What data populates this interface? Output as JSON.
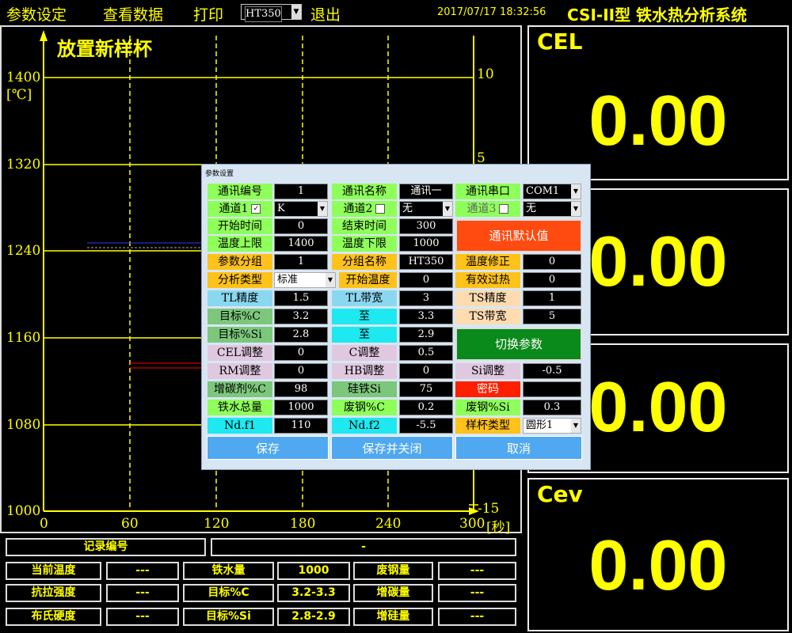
{
  "menu": {
    "params": "参数设定",
    "view": "查看数据",
    "print": "打印",
    "grade_select": "HT350",
    "exit": "退出",
    "datetime": "2017/07/17 18:32:56",
    "system_title": "CSI-II型 铁水热分析系统"
  },
  "chart": {
    "title": "放置新样杯",
    "yunit": "[℃]",
    "y_ticks": [
      "1400",
      "1320",
      "1240",
      "1160",
      "1080",
      "1000"
    ],
    "x_ticks": [
      "0",
      "60",
      "120",
      "180",
      "240",
      "300"
    ],
    "xunit": "[秒]",
    "y2_ticks": [
      "10",
      "5",
      "-15"
    ]
  },
  "chart_data": {
    "type": "line",
    "title": "",
    "xlabel": "[秒]",
    "ylabel": "[℃]",
    "xlim": [
      0,
      300
    ],
    "ylim": [
      1000,
      1400
    ],
    "y2lim": [
      -15,
      10
    ],
    "grid": true,
    "series": []
  },
  "panels": [
    {
      "label": "CEL",
      "value": "0.00"
    },
    {
      "label": "",
      "value": "0.00"
    },
    {
      "label": "",
      "value": "0.00"
    },
    {
      "label": "Cev",
      "value": "0.00"
    }
  ],
  "bottom": {
    "record_label": "记录编号",
    "record_value": "-",
    "rows": [
      [
        "当前温度",
        "---",
        "铁水量",
        "1000",
        "废钢量",
        "---"
      ],
      [
        "抗拉强度",
        "---",
        "目标%C",
        "3.2-3.3",
        "增碳量",
        "---"
      ],
      [
        "布氏硬度",
        "---",
        "目标%Si",
        "2.8-2.9",
        "增硅量",
        "---"
      ]
    ]
  },
  "dialog": {
    "caption": "参数设置",
    "comm_no_label": "通讯编号",
    "comm_no": "1",
    "comm_name_label": "通讯名称",
    "comm_name": "通讯一",
    "comm_port_label": "通讯串口",
    "comm_port": "COM1",
    "ch1_label": "通道1",
    "ch1": "K",
    "ch2_label": "通道2",
    "ch2": "无",
    "ch3_label": "通道3",
    "ch3": "无",
    "start_time_label": "开始时间",
    "start_time": "0",
    "end_time_label": "结束时间",
    "end_time": "300",
    "default_btn": "通讯默认值",
    "temp_upper_label": "温度上限",
    "temp_upper": "1400",
    "temp_lower_label": "温度下限",
    "temp_lower": "1000",
    "group_label": "参数分组",
    "group": "1",
    "group_name_label": "分组名称",
    "group_name": "HT350",
    "temp_corr_label": "温度修正",
    "temp_corr": "0",
    "analysis_type_label": "分析类型",
    "analysis_type": "标准",
    "start_temp_label": "开始温度",
    "start_temp": "0",
    "eff_super_label": "有效过热",
    "eff_super": "0",
    "tl_prec_label": "TL精度",
    "tl_prec": "1.5",
    "tl_band_label": "TL带宽",
    "tl_band": "3",
    "ts_prec_label": "TS精度",
    "ts_prec": "1",
    "target_c_label": "目标%C",
    "target_c_lo": "3.2",
    "to1": "至",
    "target_c_hi": "3.3",
    "ts_band_label": "TS带宽",
    "ts_band": "5",
    "target_si_label": "目标%Si",
    "target_si_lo": "2.8",
    "to2": "至",
    "target_si_hi": "2.9",
    "switch_btn": "切换参数",
    "cel_adj_label": "CEL调整",
    "cel_adj": "0",
    "c_adj_label": "C调整",
    "c_adj": "0.5",
    "rm_adj_label": "RM调整",
    "rm_adj": "0",
    "hb_adj_label": "HB调整",
    "hb_adj": "0",
    "si_adj_label": "Si调整",
    "si_adj": "-0.5",
    "carb_label": "增碳剂%C",
    "carb": "98",
    "fesi_label": "硅铁Si",
    "fesi": "75",
    "pwd_label": "密码",
    "pwd": "",
    "iron_total_label": "铁水总量",
    "iron_total": "1000",
    "scrap_c_label": "废钢%C",
    "scrap_c": "0.2",
    "scrap_si_label": "废钢%Si",
    "scrap_si": "0.3",
    "ndf1_label": "Nd.f1",
    "ndf1": "110",
    "ndf2_label": "Nd.f2",
    "ndf2": "-5.5",
    "cup_type_label": "样杯类型",
    "cup_type": "圆形1",
    "save": "保存",
    "save_close": "保存并关闭",
    "cancel": "取消"
  },
  "colors": {
    "accent": "#ffff00",
    "background": "#000000"
  }
}
